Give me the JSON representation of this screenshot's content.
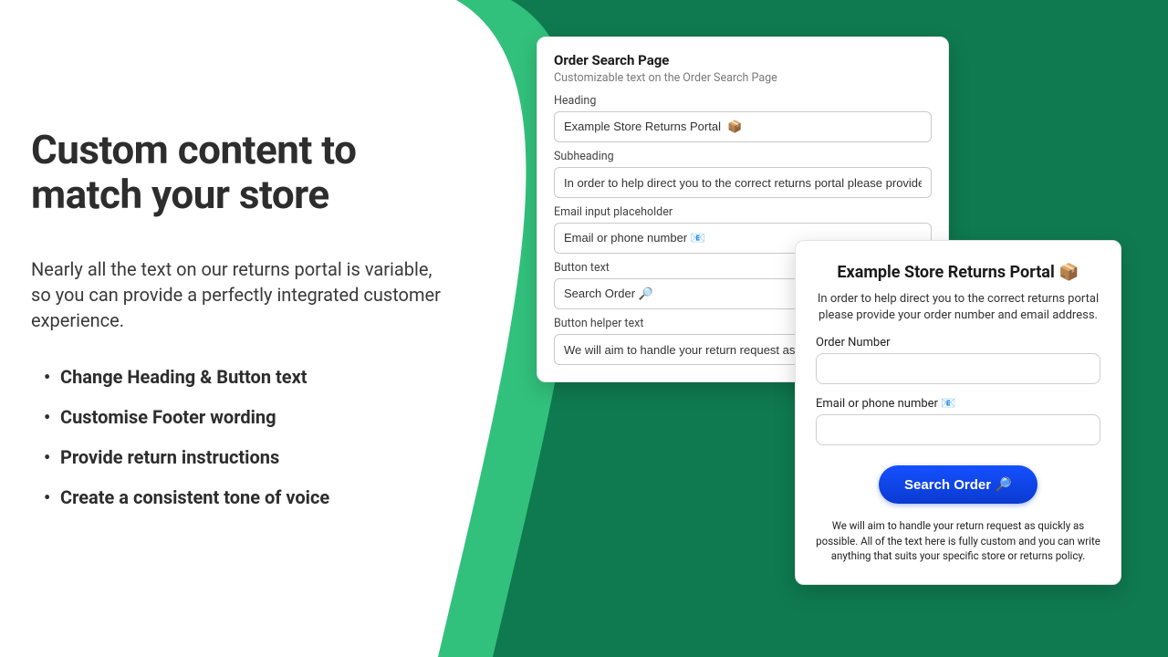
{
  "colors": {
    "wedge_dark": "#0f7a4f",
    "wedge_light": "#32c17c",
    "button_bg": "#0b3fd6"
  },
  "marketing": {
    "headline": "Custom content to match your store",
    "subhead": "Nearly all the text on our returns portal is variable, so you can provide a perfectly integrated customer experience.",
    "bullets": [
      "Change Heading & Button text",
      "Customise Footer wording",
      "Provide return instructions",
      "Create a consistent tone of voice"
    ]
  },
  "admin": {
    "title": "Order Search Page",
    "description": "Customizable text on the Order Search Page",
    "fields": {
      "heading_label": "Heading",
      "heading_value": "Example Store Returns Portal  📦",
      "subheading_label": "Subheading",
      "subheading_value": "In order to help direct you to the correct returns portal please provide your order n",
      "email_ph_label": "Email input placeholder",
      "email_ph_value": "Email or phone number 📧",
      "button_text_label": "Button text",
      "button_text_value": "Search Order 🔎",
      "button_helper_label": "Button helper text",
      "button_helper_value": "We will aim to handle your return request as quickl"
    }
  },
  "portal": {
    "title": "Example Store Returns Portal 📦",
    "subhead": "In order to help direct you to the correct returns portal please provide your order number and email address.",
    "order_label": "Order Number",
    "email_label": "Email or phone number 📧",
    "button_label": "Search Order 🔎",
    "helper": "We will aim to handle your return request as quickly as possible. All of the text here is fully custom and you can write anything that suits your specific store or returns policy."
  }
}
